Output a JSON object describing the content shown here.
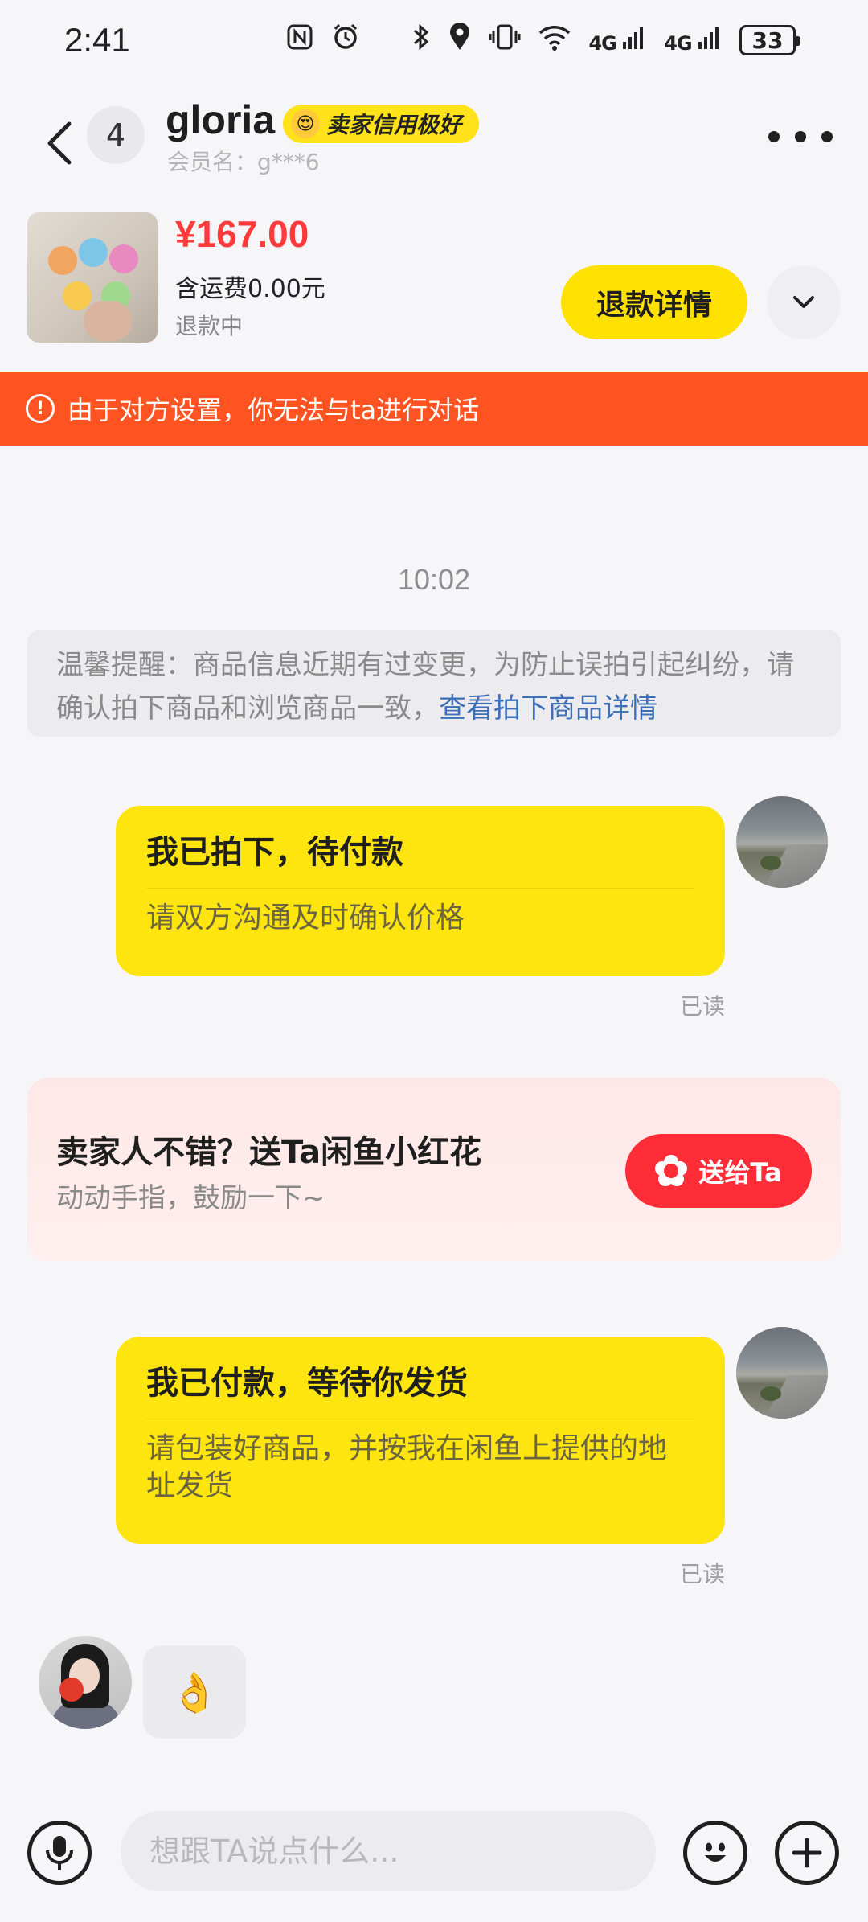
{
  "status_bar": {
    "time": "2:41",
    "signal_1": "4G",
    "signal_2": "4G",
    "battery": "33"
  },
  "header": {
    "unread_count": "4",
    "user_name": "gloria",
    "credit_badge": "卖家信用极好",
    "member_name": "会员名：g***6"
  },
  "product": {
    "price": "¥167.00",
    "shipping": "含运费0.00元",
    "status": "退款中",
    "refund_button": "退款详情"
  },
  "warning": {
    "text": "由于对方设置，你无法与ta进行对话"
  },
  "chat": {
    "timestamp": "10:02",
    "notice_text": "温馨提醒：商品信息近期有过变更，为防止误拍引起纠纷，请确认拍下商品和浏览商品一致，",
    "notice_link": "查看拍下商品详情",
    "messages": [
      {
        "title": "我已拍下，待付款",
        "subtitle": "请双方沟通及时确认价格",
        "read": "已读"
      },
      {
        "title": "我已付款，等待你发货",
        "subtitle": "请包装好商品，并按我在闲鱼上提供的地址发货",
        "read": "已读"
      }
    ],
    "flower_card": {
      "title": "卖家人不错？送Ta闲鱼小红花",
      "subtitle": "动动手指，鼓励一下~",
      "button": "送给Ta"
    },
    "reply_emoji": "👌"
  },
  "input": {
    "placeholder": "想跟TA说点什么..."
  },
  "colors": {
    "accent_yellow": "#ffe50f",
    "warning_orange": "#ff5322",
    "price_red": "#ff3a3a",
    "send_red": "#ff2d38"
  }
}
